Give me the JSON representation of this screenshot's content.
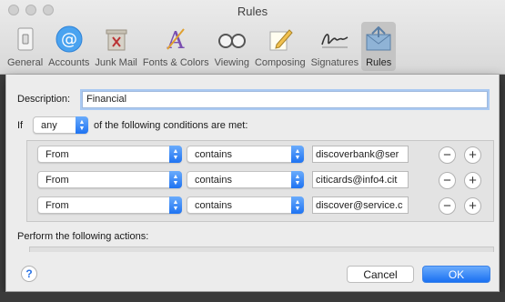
{
  "window": {
    "title": "Rules"
  },
  "toolbar": {
    "items": [
      {
        "label": "General",
        "icon": "light-switch-icon"
      },
      {
        "label": "Accounts",
        "icon": "at-sign-icon"
      },
      {
        "label": "Junk Mail",
        "icon": "trash-bin-icon"
      },
      {
        "label": "Fonts & Colors",
        "icon": "fonts-colors-icon"
      },
      {
        "label": "Viewing",
        "icon": "glasses-icon"
      },
      {
        "label": "Composing",
        "icon": "pencil-icon"
      },
      {
        "label": "Signatures",
        "icon": "signature-icon"
      },
      {
        "label": "Rules",
        "icon": "envelope-rules-icon",
        "selected": true
      }
    ]
  },
  "sheet": {
    "description_label": "Description:",
    "description_value": "Financial",
    "if_label": "If",
    "match_mode": "any",
    "conditions_suffix": "of the following conditions are met:",
    "conditions": [
      {
        "field": "From",
        "operator": "contains",
        "value": "discoverbank@ser"
      },
      {
        "field": "From",
        "operator": "contains",
        "value": "citicards@info4.cit"
      },
      {
        "field": "From",
        "operator": "contains",
        "value": "discover@service.c"
      }
    ],
    "remove_symbol": "−",
    "add_symbol": "+",
    "actions_label": "Perform the following actions:",
    "help_symbol": "?",
    "cancel_label": "Cancel",
    "ok_label": "OK"
  },
  "colors": {
    "accent": "#1e73f2",
    "focus_ring": "#a9c9f2",
    "sheet_bg": "#ececec"
  }
}
